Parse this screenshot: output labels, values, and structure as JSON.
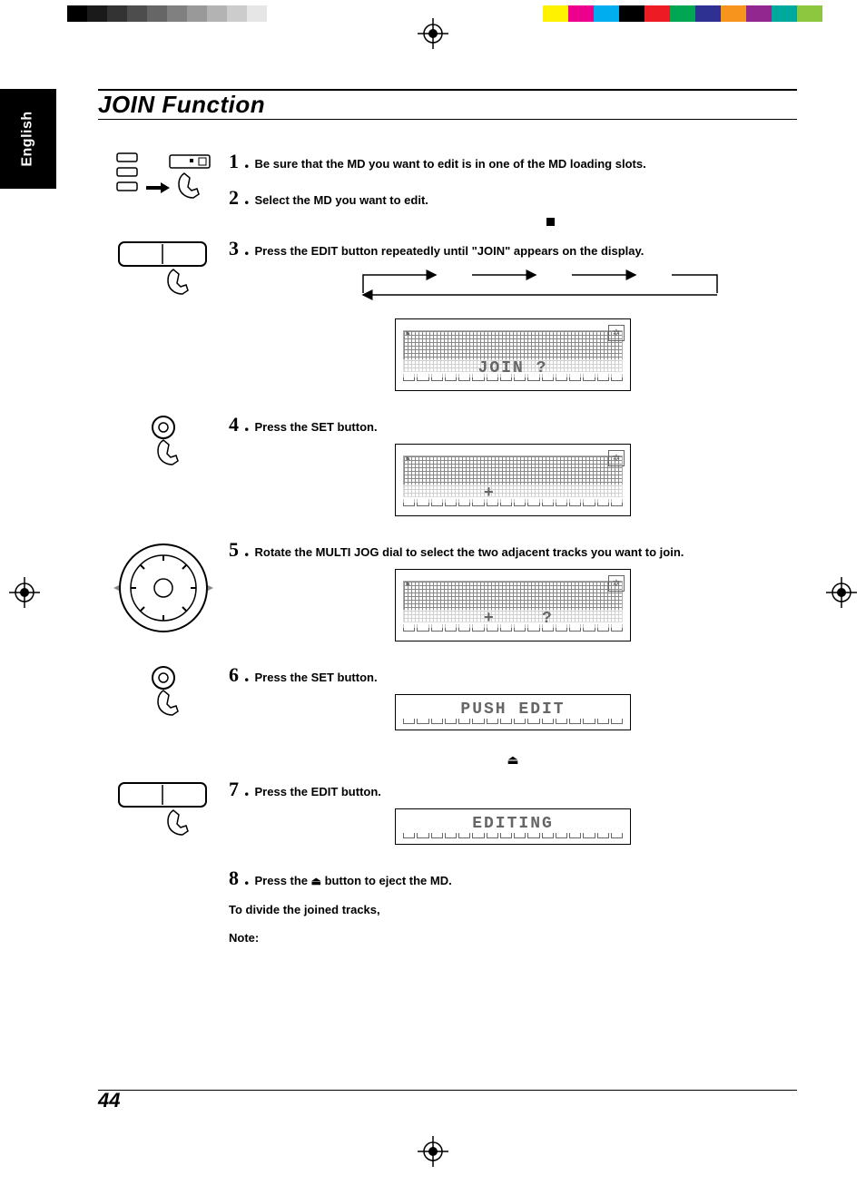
{
  "language_tab": "English",
  "title": "JOIN Function",
  "page_number": "44",
  "steps": {
    "1": {
      "num": "1",
      "text": "Be sure that the MD you want to edit is in one of the MD loading slots."
    },
    "2": {
      "num": "2",
      "text": "Select the MD you want to edit."
    },
    "3": {
      "num": "3",
      "text": "Press the EDIT button repeatedly  until \"JOIN\" appears on the display."
    },
    "4": {
      "num": "4",
      "text": "Press the SET button."
    },
    "5": {
      "num": "5",
      "text": "Rotate the MULTI JOG dial to select the two adjacent tracks you want to join."
    },
    "6": {
      "num": "6",
      "text": "Press the SET button."
    },
    "7": {
      "num": "7",
      "text": "Press the EDIT button."
    },
    "8": {
      "num": "8",
      "prefix": "Press the ",
      "suffix": " button to eject the MD."
    }
  },
  "lcd": {
    "join": "JOIN  ?",
    "push_edit": "PUSH EDIT",
    "editing": "EDITING"
  },
  "subhead_divide": "To divide the joined tracks,",
  "note_label": "Note:",
  "registration_colors_left": [
    "#000",
    "#1a1a1a",
    "#333",
    "#4d4d4d",
    "#666",
    "#808080",
    "#999",
    "#b3b3b3",
    "#ccc",
    "#e6e6e6",
    "#fff"
  ],
  "registration_colors_right": [
    "#fff200",
    "#ec008c",
    "#00aeef",
    "#000",
    "#ed1c24",
    "#00a651",
    "#2e3192",
    "#f7941e",
    "#92278f",
    "#00a99d",
    "#8dc63f"
  ]
}
